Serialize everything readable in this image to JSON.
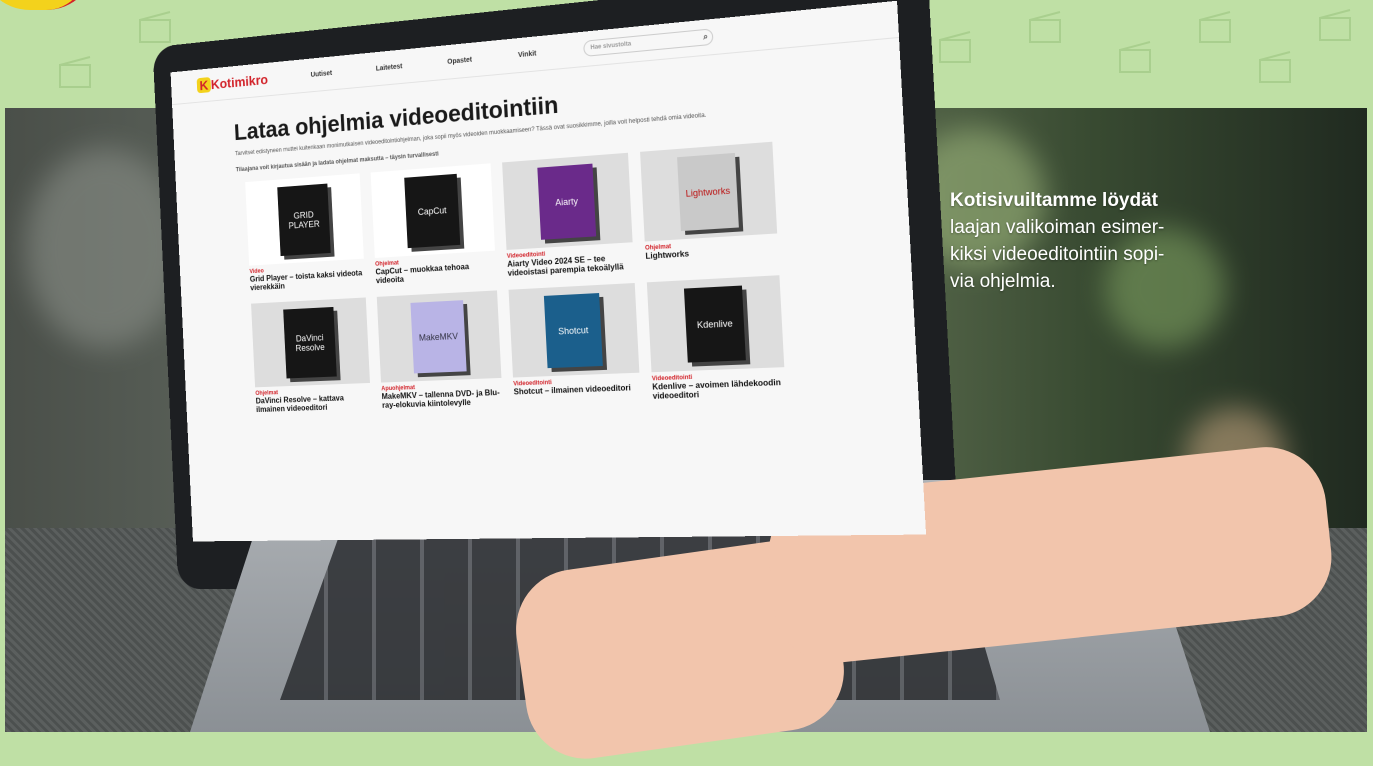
{
  "caption": {
    "lead": "Kotisivuiltamme löydät",
    "lines": [
      "laajan valikoiman esimer-",
      "kiksi videoeditointiin sopi-",
      "via ohjelmia."
    ]
  },
  "website": {
    "logo": "Kotimikro",
    "nav": [
      "Uutiset",
      "Laitetest",
      "Opastet",
      "Vinkit"
    ],
    "search_placeholder": "Hae sivustolta",
    "page_title": "Lataa ohjelmia videoeditointiin",
    "intro": "Tarvitset edistyneen muttei kuitenkaan monimutkaisen videoeditointiohjelman, joka sopii myös videoiden muokkaamiseen? Tässä ovat suosikkimme, joilla voit helposti tehdä omia videoita.",
    "intro2": "Tilaajana voit kirjautua sisään ja ladata ohjelmat maksutta – täysin turvallisesti",
    "cards": [
      {
        "box": "GRID PLAYER",
        "cat": "Video",
        "name": "Grid Player – toista kaksi videota vierekkäin"
      },
      {
        "box": "CapCut",
        "cat": "Ohjelmat",
        "name": "CapCut – muokkaa tehoaa videoita"
      },
      {
        "box": "Aiarty",
        "cat": "Videoeditointi",
        "name": "Aiarty Video 2024 SE – tee videoistasi parempia tekoälyllä"
      },
      {
        "box": "Lightworks",
        "cat": "Ohjelmat",
        "name": "Lightworks"
      },
      {
        "box": "DaVinci Resolve",
        "cat": "Ohjelmat",
        "name": "DaVinci Resolve – kattava ilmainen videoeditori"
      },
      {
        "box": "MakeMKV",
        "cat": "Apuohjelmat",
        "name": "MakeMKV – tallenna DVD- ja Blu-ray-elokuvia kiintolevylle"
      },
      {
        "box": "Shotcut",
        "cat": "Videoeditointi",
        "name": "Shotcut – ilmainen videoeditori"
      },
      {
        "box": "Kdenlive",
        "cat": "Videoeditointi",
        "name": "Kdenlive – avoimen lähdekoodin videoeditori"
      }
    ]
  }
}
